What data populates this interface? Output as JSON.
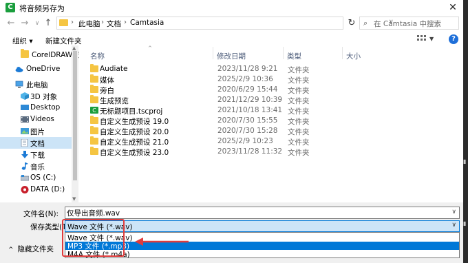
{
  "window": {
    "title": "将音频另存为",
    "app_icon_letter": "C",
    "close_glyph": "✕"
  },
  "address": {
    "crumbs": [
      "此电脑",
      "文档",
      "Camtasia"
    ],
    "separator": "›"
  },
  "search": {
    "placeholder": "在 Camtasia 中搜索"
  },
  "toolbar": {
    "organize_label": "组织 ▾",
    "new_folder_label": "新建文件夹",
    "help_glyph": "?"
  },
  "nav": {
    "items": [
      {
        "label": "CorelDRAW资料",
        "icon": "folder-icon"
      },
      {
        "label": "OneDrive",
        "icon": "cloud-icon"
      },
      {
        "label": "此电脑",
        "icon": "computer-icon"
      },
      {
        "label": "3D 对象",
        "icon": "3d-objects-icon"
      },
      {
        "label": "Desktop",
        "icon": "desktop-icon"
      },
      {
        "label": "Videos",
        "icon": "videos-icon"
      },
      {
        "label": "图片",
        "icon": "pictures-icon"
      },
      {
        "label": "文档",
        "icon": "documents-icon",
        "selected": true
      },
      {
        "label": "下载",
        "icon": "download-icon"
      },
      {
        "label": "音乐",
        "icon": "music-icon"
      },
      {
        "label": "OS (C:)",
        "icon": "drive-icon"
      },
      {
        "label": "DATA (D:)",
        "icon": "drive-data-icon"
      }
    ]
  },
  "columns": {
    "name": "名称",
    "modified": "修改日期",
    "type": "类型",
    "size": "大小"
  },
  "files": [
    {
      "name": "Audiate",
      "date": "2023/11/28 9:21",
      "type": "文件夹",
      "kind": "folder"
    },
    {
      "name": "媒体",
      "date": "2025/2/9 10:36",
      "type": "文件夹",
      "kind": "folder"
    },
    {
      "name": "旁白",
      "date": "2020/6/29 15:44",
      "type": "文件夹",
      "kind": "folder"
    },
    {
      "name": "生成预览",
      "date": "2021/12/29 10:39",
      "type": "文件夹",
      "kind": "folder"
    },
    {
      "name": "无标题项目.tscproj",
      "date": "2021/10/18 13:41",
      "type": "文件夹",
      "kind": "project"
    },
    {
      "name": "自定义生成预设 19.0",
      "date": "2020/7/30 15:55",
      "type": "文件夹",
      "kind": "folder"
    },
    {
      "name": "自定义生成预设 20.0",
      "date": "2020/7/30 15:28",
      "type": "文件夹",
      "kind": "folder"
    },
    {
      "name": "自定义生成预设 21.0",
      "date": "2025/2/9 10:23",
      "type": "文件夹",
      "kind": "folder"
    },
    {
      "name": "自定义生成预设 23.0",
      "date": "2023/11/28 11:32",
      "type": "文件夹",
      "kind": "folder"
    }
  ],
  "form": {
    "filename_label": "文件名(N):",
    "filename_value": "仅导出音频.wav",
    "savetype_label": "保存类型(T):",
    "savetype_value": "Wave 文件 (*.wav)",
    "options": [
      "Wave 文件 (*.wav)",
      "MP3 文件 (*.mp3)",
      "M4A 文件 (*.m4a)"
    ],
    "highlighted_option": "MP3 文件 (*.mp3)"
  },
  "footer": {
    "hide_folders_label": "隐藏文件夹",
    "hide_folders_chevron": "^"
  },
  "colors": {
    "accent": "#0078d7",
    "selection": "#cce4f7",
    "annotation": "#e03c3c",
    "folder": "#f5c542"
  }
}
